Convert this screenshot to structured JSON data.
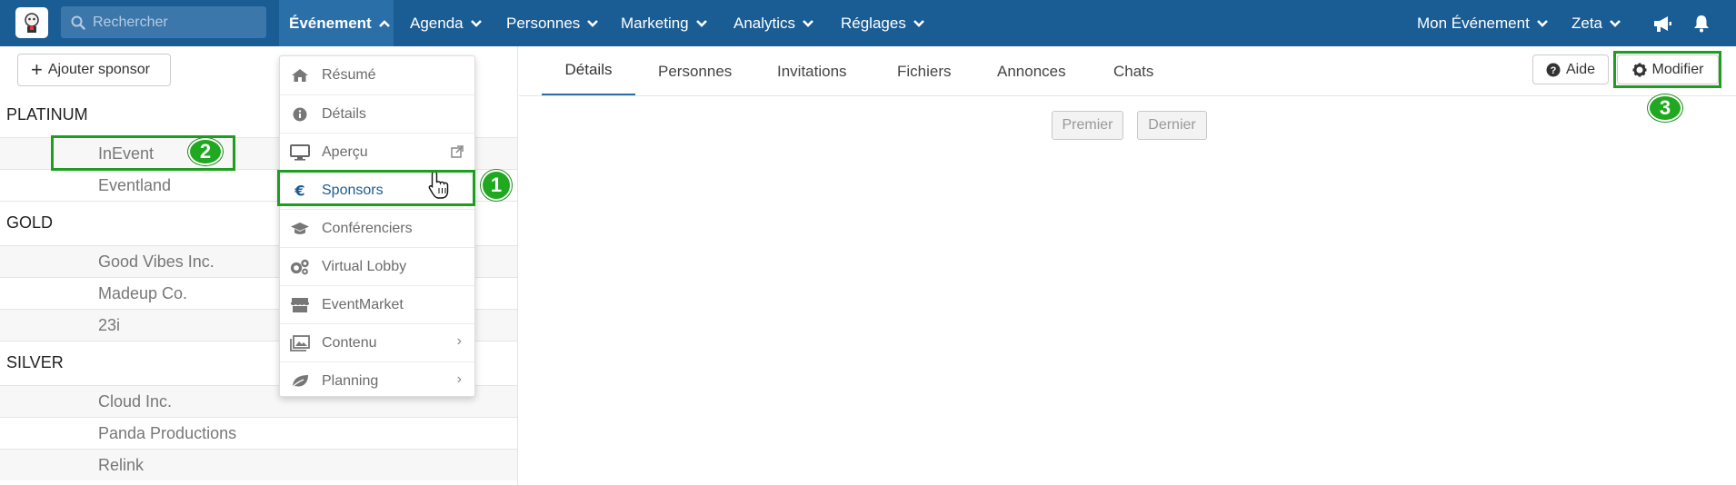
{
  "search": {
    "placeholder": "Rechercher"
  },
  "nav": {
    "items": [
      {
        "label": "Événement"
      },
      {
        "label": "Agenda"
      },
      {
        "label": "Personnes"
      },
      {
        "label": "Marketing"
      },
      {
        "label": "Analytics"
      },
      {
        "label": "Réglages"
      }
    ],
    "right": [
      {
        "label": "Mon Événement"
      },
      {
        "label": "Zeta"
      }
    ]
  },
  "sidebar": {
    "add_label": "Ajouter sponsor",
    "groups": [
      {
        "title": "PLATINUM",
        "items": [
          "InEvent",
          "Eventland"
        ]
      },
      {
        "title": "GOLD",
        "items": [
          "Good Vibes Inc.",
          "Madeup Co.",
          "23i"
        ]
      },
      {
        "title": "SILVER",
        "items": [
          "Cloud Inc.",
          "Panda Productions",
          "Relink"
        ]
      }
    ]
  },
  "menu": {
    "items": [
      {
        "label": "Résumé",
        "icon": "home-icon"
      },
      {
        "label": "Détails",
        "icon": "info-icon"
      },
      {
        "label": "Aperçu",
        "icon": "monitor-icon"
      },
      {
        "label": "Sponsors",
        "icon": "euro-icon"
      },
      {
        "label": "Conférenciers",
        "icon": "graduation-cap-icon"
      },
      {
        "label": "Virtual Lobby",
        "icon": "gears-icon"
      },
      {
        "label": "EventMarket",
        "icon": "store-icon"
      },
      {
        "label": "Contenu",
        "icon": "image-icon"
      },
      {
        "label": "Planning",
        "icon": "leaf-icon"
      }
    ]
  },
  "tabs": [
    {
      "label": "Détails"
    },
    {
      "label": "Personnes"
    },
    {
      "label": "Invitations"
    },
    {
      "label": "Fichiers"
    },
    {
      "label": "Annonces"
    },
    {
      "label": "Chats"
    }
  ],
  "toolbar": {
    "help_label": "Aide",
    "edit_label": "Modifier"
  },
  "pager": {
    "first_label": "Premier",
    "last_label": "Dernier"
  },
  "annotations": {
    "step1": "1",
    "step2": "2",
    "step3": "3"
  },
  "colors": {
    "nav_bg": "#1a5c94",
    "highlight": "#1e9e1e"
  }
}
